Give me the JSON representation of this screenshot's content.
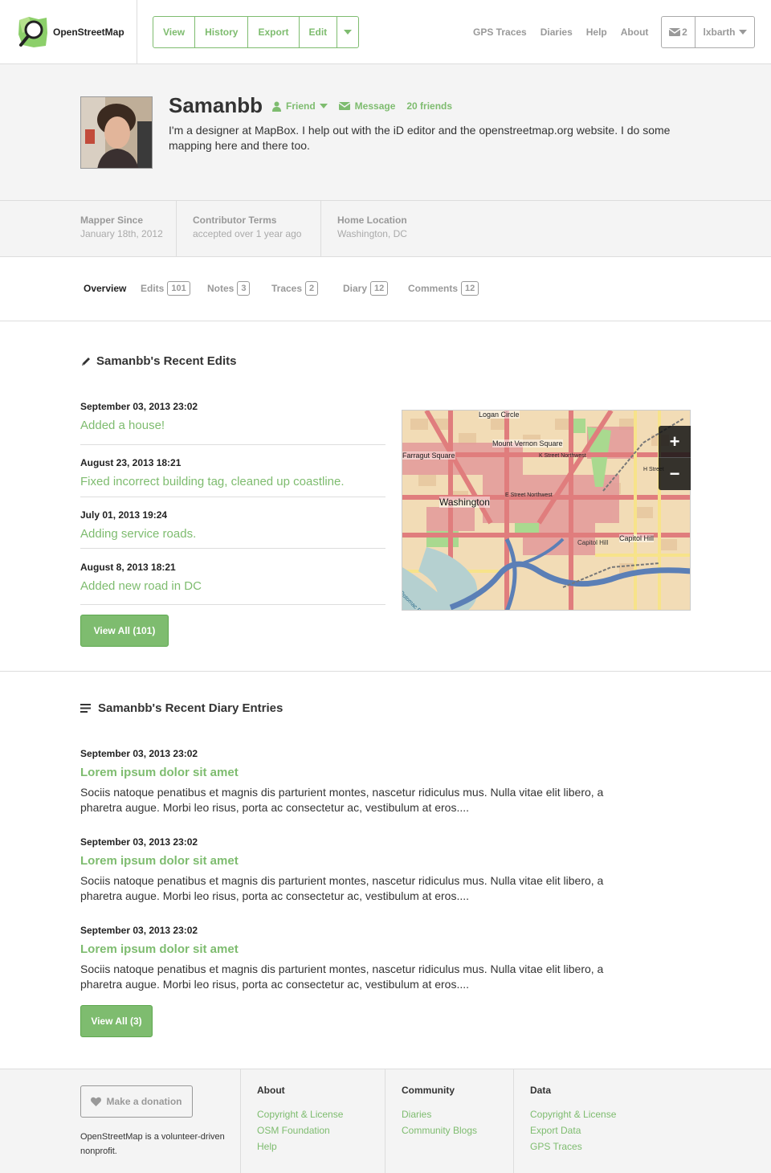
{
  "header": {
    "brand": "OpenStreetMap",
    "actions": [
      {
        "label": "View"
      },
      {
        "label": "History"
      },
      {
        "label": "Export"
      },
      {
        "label": "Edit"
      }
    ],
    "nav": [
      "GPS Traces",
      "Diaries",
      "Help",
      "About"
    ],
    "inbox_count": "2",
    "username": "lxbarth"
  },
  "profile": {
    "name": "Samanbb",
    "friend_label": "Friend",
    "message_label": "Message",
    "friends_label": "20 friends",
    "bio": "I'm a designer at MapBox. I help out with the iD editor and the openstreetmap.org website. I do some mapping here and there too."
  },
  "stats": [
    {
      "label": "Mapper Since",
      "value": "January 18th, 2012"
    },
    {
      "label": "Contributor Terms",
      "value": "accepted over 1 year ago"
    },
    {
      "label": "Home Location",
      "value": "Washington, DC"
    }
  ],
  "tabs": [
    {
      "label": "Overview",
      "count": ""
    },
    {
      "label": "Edits",
      "count": "101"
    },
    {
      "label": "Notes",
      "count": "3"
    },
    {
      "label": "Traces",
      "count": "2"
    },
    {
      "label": "Diary",
      "count": "12"
    },
    {
      "label": "Comments",
      "count": "12"
    }
  ],
  "edits": {
    "title": "Samanbb's Recent Edits",
    "items": [
      {
        "date": "September 03, 2013 23:02",
        "text": "Added a house!"
      },
      {
        "date": "August 23, 2013 18:21",
        "text": "Fixed incorrect building tag, cleaned up coastline."
      },
      {
        "date": "July 01, 2013 19:24",
        "text": "Adding service roads."
      },
      {
        "date": "August 8, 2013 18:21",
        "text": "Added new road in DC"
      }
    ],
    "view_all": "View All (101)"
  },
  "map": {
    "labels": {
      "logan": "Logan Circle",
      "vernon": "Mount Vernon Square",
      "farragut": "Farragut Square",
      "kstreet": "K Street Northwest",
      "estreet": "E Street Northwest",
      "washington": "Washington",
      "capitol_hill": "Capitol Hill",
      "capitol_hill2": "Capitol Hill",
      "hstreet": "H Street",
      "potomac": "Potomac River"
    },
    "zoom_in": "+",
    "zoom_out": "−"
  },
  "diary": {
    "title": "Samanbb's Recent Diary Entries",
    "items": [
      {
        "date": "September 03, 2013 23:02",
        "title": "Lorem ipsum dolor sit amet",
        "body": "Sociis natoque penatibus et magnis dis parturient montes, nascetur ridiculus mus. Nulla vitae elit libero, a pharetra augue. Morbi leo risus, porta ac consectetur ac, vestibulum at eros...."
      },
      {
        "date": "September 03, 2013 23:02",
        "title": "Lorem ipsum dolor sit amet",
        "body": "Sociis natoque penatibus et magnis dis parturient montes, nascetur ridiculus mus. Nulla vitae elit libero, a pharetra augue. Morbi leo risus, porta ac consectetur ac, vestibulum at eros...."
      },
      {
        "date": "September 03, 2013 23:02",
        "title": "Lorem ipsum dolor sit amet",
        "body": "Sociis natoque penatibus et magnis dis parturient montes, nascetur ridiculus mus. Nulla vitae elit libero, a pharetra augue. Morbi leo risus, porta ac consectetur ac, vestibulum at eros...."
      }
    ],
    "view_all": "View All (3)"
  },
  "footer": {
    "donate": "Make a donation",
    "note": "OpenStreetMap is a volunteer-driven nonprofit.",
    "about": {
      "heading": "About",
      "links": [
        "Copyright & License",
        "OSM Foundation",
        "Help"
      ]
    },
    "community": {
      "heading": "Community",
      "links": [
        "Diaries",
        "Community Blogs"
      ]
    },
    "data": {
      "heading": "Data",
      "links": [
        "Copyright & License",
        "Export Data",
        "GPS Traces"
      ]
    }
  },
  "colors": {
    "accent": "#7ebc6f",
    "panel": "#f4f4f4"
  },
  "icons": [
    "logo-magnifier-icon",
    "caret-down-icon",
    "friend-user-icon",
    "envelope-icon",
    "pencil-icon",
    "list-icon",
    "heart-icon"
  ]
}
